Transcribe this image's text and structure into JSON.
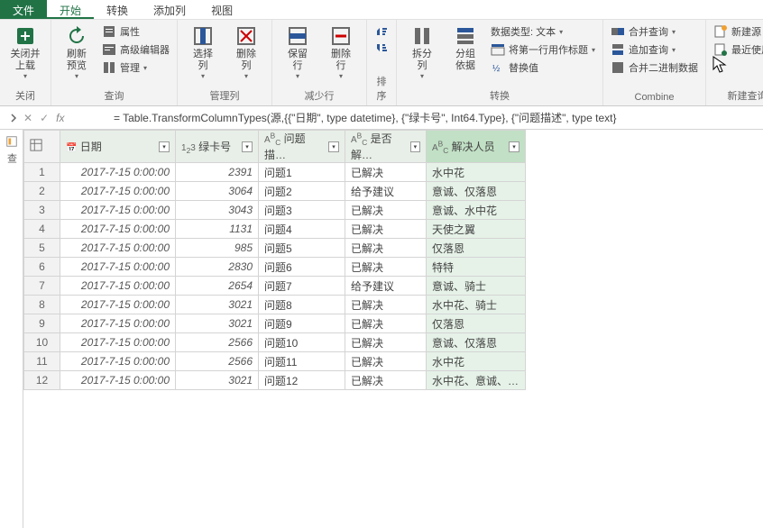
{
  "tabs": {
    "file": "文件",
    "home": "开始",
    "transform": "转换",
    "addcol": "添加列",
    "view": "视图"
  },
  "ribbon": {
    "close": {
      "closeBtn": "关闭并\n上载",
      "label": "关闭"
    },
    "query": {
      "refresh": "刷新\n预览",
      "properties": "属性",
      "advEditor": "高级编辑器",
      "manage": "管理",
      "label": "查询"
    },
    "cols": {
      "selectCols": "选择\n列",
      "removeCols": "删除\n列",
      "label": "管理列"
    },
    "rows": {
      "keepRows": "保留\n行",
      "removeRows": "删除\n行",
      "label": "减少行"
    },
    "sort": {
      "label": "排序"
    },
    "transform": {
      "split": "拆分\n列",
      "group": "分组\n依据",
      "dataType": "数据类型: 文本",
      "firstRow": "将第一行用作标题",
      "replace": "替换值",
      "label": "转换"
    },
    "combine": {
      "merge": "合并查询",
      "append": "追加查询",
      "combineBin": "合并二进制数据",
      "label": "Combine"
    },
    "newq": {
      "newSrc": "新建源",
      "recent": "最近使用的",
      "label": "新建查询"
    }
  },
  "formula": "= Table.TransformColumnTypes(源,{{\"日期\", type datetime}, {\"绿卡号\", Int64.Type}, {\"问题描述\", type text}",
  "columns": {
    "date": "日期",
    "card": "绿卡号",
    "desc": "问题描…",
    "solved": "是否解…",
    "person": "解决人员"
  },
  "rows": [
    {
      "date": "2017-7-15 0:00:00",
      "card": "2391",
      "q": "问题1",
      "solved": "已解决",
      "person": "水中花"
    },
    {
      "date": "2017-7-15 0:00:00",
      "card": "3064",
      "q": "问题2",
      "solved": "给予建议",
      "person": "意诚、仅落恩"
    },
    {
      "date": "2017-7-15 0:00:00",
      "card": "3043",
      "q": "问题3",
      "solved": "已解决",
      "person": "意诚、水中花"
    },
    {
      "date": "2017-7-15 0:00:00",
      "card": "1131",
      "q": "问题4",
      "solved": "已解决",
      "person": "天使之翼"
    },
    {
      "date": "2017-7-15 0:00:00",
      "card": "985",
      "q": "问题5",
      "solved": "已解决",
      "person": "仅落恩"
    },
    {
      "date": "2017-7-15 0:00:00",
      "card": "2830",
      "q": "问题6",
      "solved": "已解决",
      "person": "特特"
    },
    {
      "date": "2017-7-15 0:00:00",
      "card": "2654",
      "q": "问题7",
      "solved": "给予建议",
      "person": "意诚、骑士"
    },
    {
      "date": "2017-7-15 0:00:00",
      "card": "3021",
      "q": "问题8",
      "solved": "已解决",
      "person": "水中花、骑士"
    },
    {
      "date": "2017-7-15 0:00:00",
      "card": "3021",
      "q": "问题9",
      "solved": "已解决",
      "person": "仅落恩"
    },
    {
      "date": "2017-7-15 0:00:00",
      "card": "2566",
      "q": "问题10",
      "solved": "已解决",
      "person": "意诚、仅落恩"
    },
    {
      "date": "2017-7-15 0:00:00",
      "card": "2566",
      "q": "问题11",
      "solved": "已解决",
      "person": "水中花"
    },
    {
      "date": "2017-7-15 0:00:00",
      "card": "3021",
      "q": "问题12",
      "solved": "已解决",
      "person": "水中花、意诚、…"
    }
  ]
}
